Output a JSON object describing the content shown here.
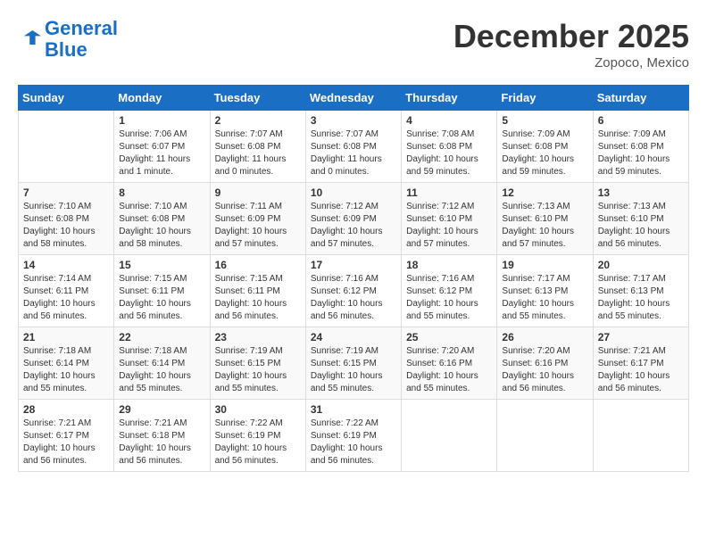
{
  "header": {
    "logo_line1": "General",
    "logo_line2": "Blue",
    "month_title": "December 2025",
    "location": "Zopoco, Mexico"
  },
  "weekdays": [
    "Sunday",
    "Monday",
    "Tuesday",
    "Wednesday",
    "Thursday",
    "Friday",
    "Saturday"
  ],
  "weeks": [
    [
      {
        "day": "",
        "info": ""
      },
      {
        "day": "1",
        "info": "Sunrise: 7:06 AM\nSunset: 6:07 PM\nDaylight: 11 hours\nand 1 minute."
      },
      {
        "day": "2",
        "info": "Sunrise: 7:07 AM\nSunset: 6:08 PM\nDaylight: 11 hours\nand 0 minutes."
      },
      {
        "day": "3",
        "info": "Sunrise: 7:07 AM\nSunset: 6:08 PM\nDaylight: 11 hours\nand 0 minutes."
      },
      {
        "day": "4",
        "info": "Sunrise: 7:08 AM\nSunset: 6:08 PM\nDaylight: 10 hours\nand 59 minutes."
      },
      {
        "day": "5",
        "info": "Sunrise: 7:09 AM\nSunset: 6:08 PM\nDaylight: 10 hours\nand 59 minutes."
      },
      {
        "day": "6",
        "info": "Sunrise: 7:09 AM\nSunset: 6:08 PM\nDaylight: 10 hours\nand 59 minutes."
      }
    ],
    [
      {
        "day": "7",
        "info": "Sunrise: 7:10 AM\nSunset: 6:08 PM\nDaylight: 10 hours\nand 58 minutes."
      },
      {
        "day": "8",
        "info": "Sunrise: 7:10 AM\nSunset: 6:08 PM\nDaylight: 10 hours\nand 58 minutes."
      },
      {
        "day": "9",
        "info": "Sunrise: 7:11 AM\nSunset: 6:09 PM\nDaylight: 10 hours\nand 57 minutes."
      },
      {
        "day": "10",
        "info": "Sunrise: 7:12 AM\nSunset: 6:09 PM\nDaylight: 10 hours\nand 57 minutes."
      },
      {
        "day": "11",
        "info": "Sunrise: 7:12 AM\nSunset: 6:10 PM\nDaylight: 10 hours\nand 57 minutes."
      },
      {
        "day": "12",
        "info": "Sunrise: 7:13 AM\nSunset: 6:10 PM\nDaylight: 10 hours\nand 57 minutes."
      },
      {
        "day": "13",
        "info": "Sunrise: 7:13 AM\nSunset: 6:10 PM\nDaylight: 10 hours\nand 56 minutes."
      }
    ],
    [
      {
        "day": "14",
        "info": "Sunrise: 7:14 AM\nSunset: 6:11 PM\nDaylight: 10 hours\nand 56 minutes."
      },
      {
        "day": "15",
        "info": "Sunrise: 7:15 AM\nSunset: 6:11 PM\nDaylight: 10 hours\nand 56 minutes."
      },
      {
        "day": "16",
        "info": "Sunrise: 7:15 AM\nSunset: 6:11 PM\nDaylight: 10 hours\nand 56 minutes."
      },
      {
        "day": "17",
        "info": "Sunrise: 7:16 AM\nSunset: 6:12 PM\nDaylight: 10 hours\nand 56 minutes."
      },
      {
        "day": "18",
        "info": "Sunrise: 7:16 AM\nSunset: 6:12 PM\nDaylight: 10 hours\nand 55 minutes."
      },
      {
        "day": "19",
        "info": "Sunrise: 7:17 AM\nSunset: 6:13 PM\nDaylight: 10 hours\nand 55 minutes."
      },
      {
        "day": "20",
        "info": "Sunrise: 7:17 AM\nSunset: 6:13 PM\nDaylight: 10 hours\nand 55 minutes."
      }
    ],
    [
      {
        "day": "21",
        "info": "Sunrise: 7:18 AM\nSunset: 6:14 PM\nDaylight: 10 hours\nand 55 minutes."
      },
      {
        "day": "22",
        "info": "Sunrise: 7:18 AM\nSunset: 6:14 PM\nDaylight: 10 hours\nand 55 minutes."
      },
      {
        "day": "23",
        "info": "Sunrise: 7:19 AM\nSunset: 6:15 PM\nDaylight: 10 hours\nand 55 minutes."
      },
      {
        "day": "24",
        "info": "Sunrise: 7:19 AM\nSunset: 6:15 PM\nDaylight: 10 hours\nand 55 minutes."
      },
      {
        "day": "25",
        "info": "Sunrise: 7:20 AM\nSunset: 6:16 PM\nDaylight: 10 hours\nand 55 minutes."
      },
      {
        "day": "26",
        "info": "Sunrise: 7:20 AM\nSunset: 6:16 PM\nDaylight: 10 hours\nand 56 minutes."
      },
      {
        "day": "27",
        "info": "Sunrise: 7:21 AM\nSunset: 6:17 PM\nDaylight: 10 hours\nand 56 minutes."
      }
    ],
    [
      {
        "day": "28",
        "info": "Sunrise: 7:21 AM\nSunset: 6:17 PM\nDaylight: 10 hours\nand 56 minutes."
      },
      {
        "day": "29",
        "info": "Sunrise: 7:21 AM\nSunset: 6:18 PM\nDaylight: 10 hours\nand 56 minutes."
      },
      {
        "day": "30",
        "info": "Sunrise: 7:22 AM\nSunset: 6:19 PM\nDaylight: 10 hours\nand 56 minutes."
      },
      {
        "day": "31",
        "info": "Sunrise: 7:22 AM\nSunset: 6:19 PM\nDaylight: 10 hours\nand 56 minutes."
      },
      {
        "day": "",
        "info": ""
      },
      {
        "day": "",
        "info": ""
      },
      {
        "day": "",
        "info": ""
      }
    ]
  ]
}
